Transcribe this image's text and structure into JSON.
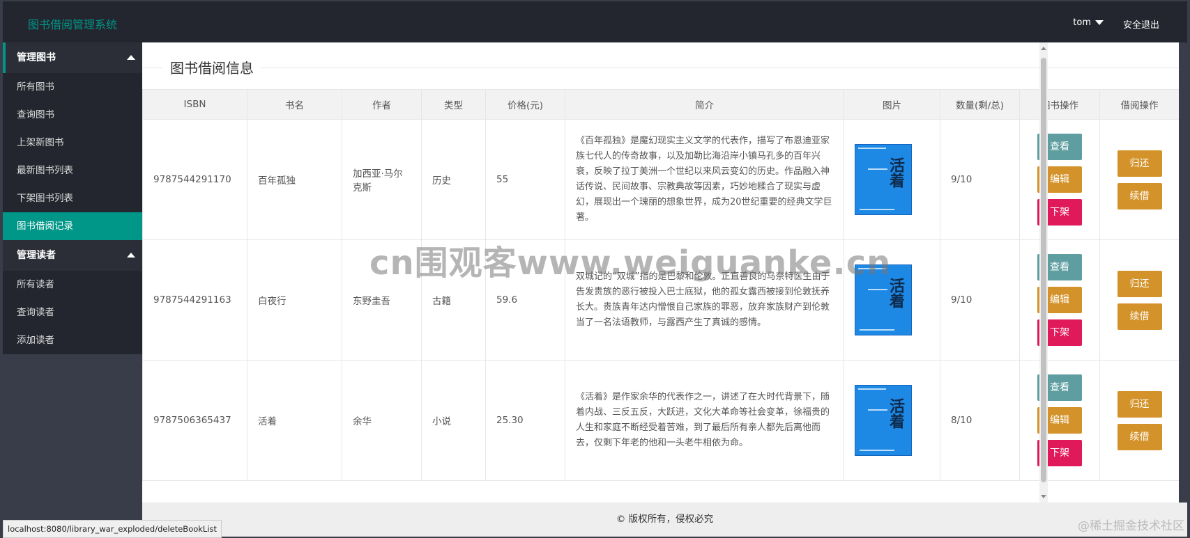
{
  "header": {
    "app_title": "图书借阅管理系统",
    "user": "tom",
    "logout": "安全退出"
  },
  "sidebar": {
    "groups": [
      {
        "label": "管理图书",
        "items": [
          "所有图书",
          "查询图书",
          "上架新图书",
          "最新图书列表",
          "下架图书列表",
          "图书借阅记录"
        ]
      },
      {
        "label": "管理读者",
        "items": [
          "所有读者",
          "查询读者",
          "添加读者"
        ]
      }
    ],
    "active_item": "图书借阅记录"
  },
  "main": {
    "section_title": "图书借阅信息",
    "columns": [
      "ISBN",
      "书名",
      "作者",
      "类型",
      "价格(元)",
      "简介",
      "图片",
      "数量(剩/总)",
      "图书操作",
      "借阅操作"
    ],
    "rows": [
      {
        "isbn": "9787544291170",
        "title": "百年孤独",
        "author": "加西亚·马尔克斯",
        "type": "历史",
        "price": "55",
        "summary": "《百年孤独》是魔幻现实主义文学的代表作，描写了布恩迪亚家族七代人的传奇故事，以及加勒比海沿岸小镇马孔多的百年兴衰，反映了拉丁美洲一个世纪以来风云变幻的历史。作品融入神话传说、民间故事、宗教典故等因素，巧妙地糅合了现实与虚幻，展现出一个瑰丽的想象世界，成为20世纪重要的经典文学巨著。",
        "qty": "9/10"
      },
      {
        "isbn": "9787544291163",
        "title": "白夜行",
        "author": "东野圭吾",
        "type": "古籍",
        "price": "59.6",
        "summary": "双城记的“双城”指的是巴黎和伦敦。正直善良的马奈特医生由于告发贵族的恶行被投入巴士底狱，他的孤女露西被接到伦敦抚养长大。贵族青年达内憎恨自己家族的罪恶，放弃家族财产到伦敦当了一名法语教师，与露西产生了真诚的感情。",
        "qty": "9/10"
      },
      {
        "isbn": "9787506365437",
        "title": "活着",
        "author": "余华",
        "type": "小说",
        "price": "25.30",
        "summary": "《活着》是作家余华的代表作之一，讲述了在大时代背景下，随着内战、三反五反，大跃进，文化大革命等社会变革，徐福贵的人生和家庭不断经受着苦难，到了最后所有亲人都先后离他而去，仅剩下年老的他和一头老牛相依为命。",
        "qty": "8/10"
      }
    ],
    "book_actions": {
      "view": "查看",
      "edit": "编辑",
      "remove": "下架"
    },
    "borrow_actions": {
      "return": "归还",
      "renew": "续借"
    },
    "cover_text": "活着"
  },
  "footer": {
    "text": "© 版权所有，侵权必究"
  },
  "statusbar": {
    "url": "localhost:8080/library_war_exploded/deleteBookList"
  },
  "watermark": {
    "text": "cn围观客www.weiguanke.cn",
    "corner": "@稀土掘金技术社区"
  },
  "colors": {
    "accent": "#009688",
    "view": "#5f9ea0",
    "edit": "#d4932a",
    "remove": "#e0195b"
  }
}
